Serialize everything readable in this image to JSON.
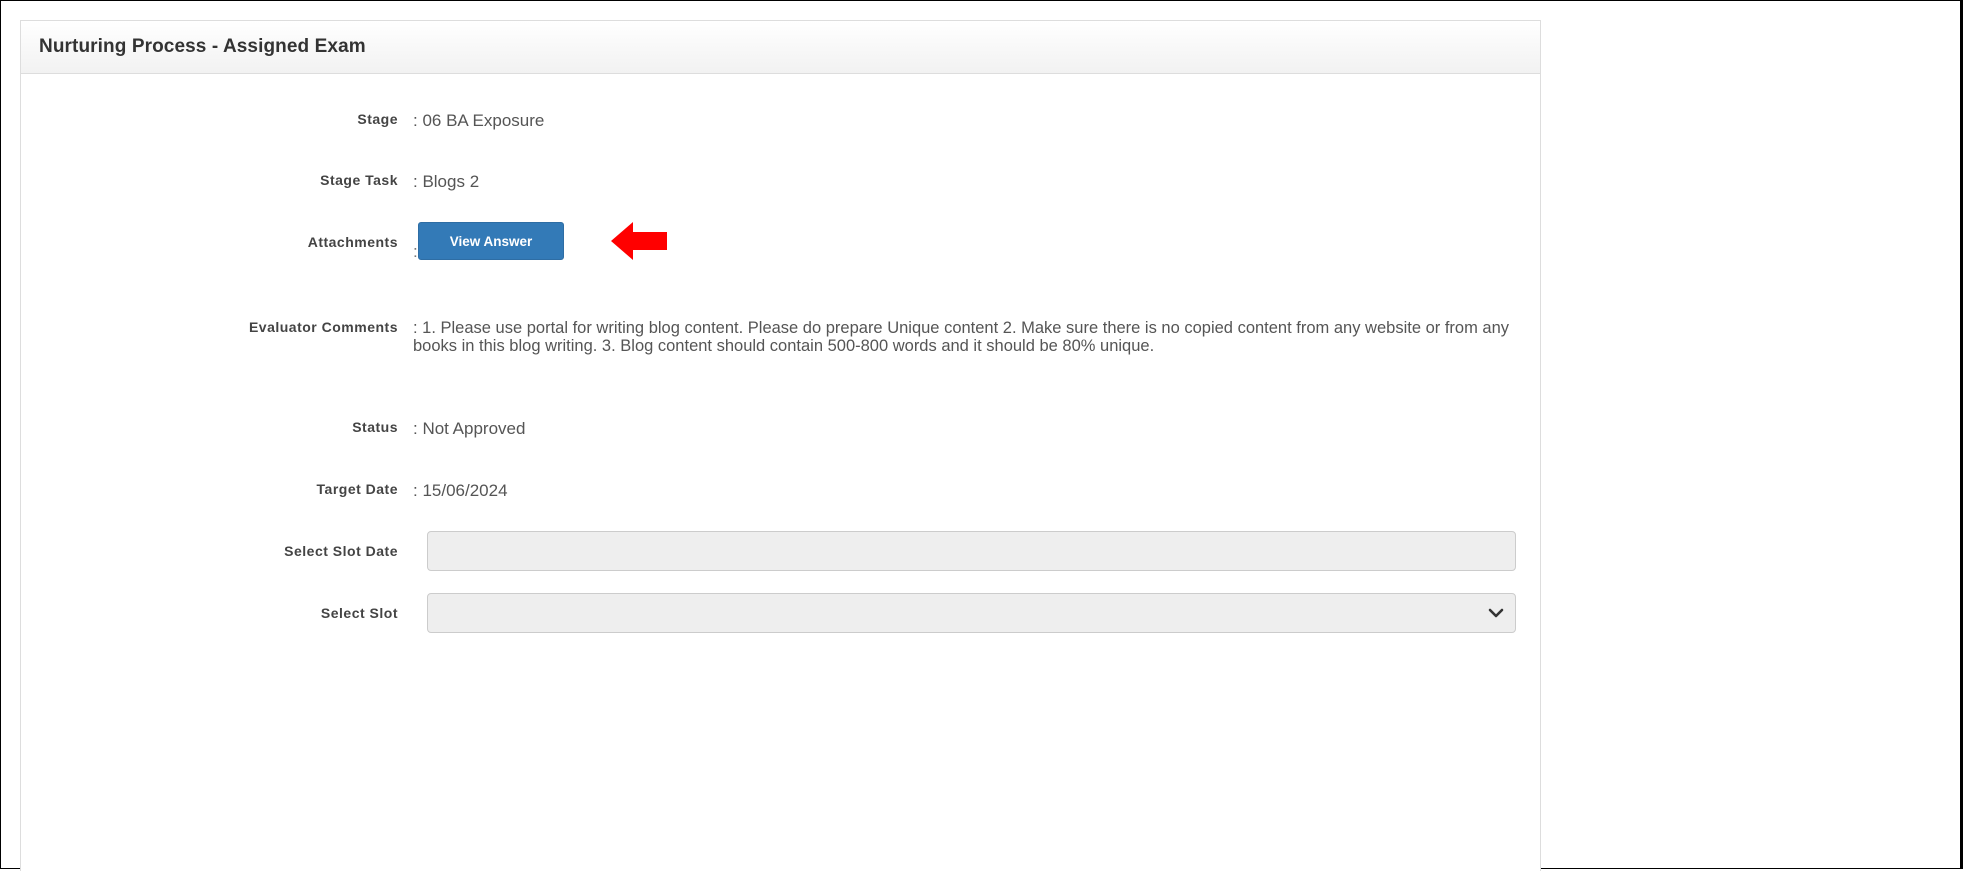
{
  "panel": {
    "title": "Nurturing Process - Assigned Exam"
  },
  "fields": {
    "stage": {
      "label": "Stage",
      "value": ": 06 BA Exposure"
    },
    "stage_task": {
      "label": "Stage Task",
      "value": ": Blogs 2"
    },
    "attachments": {
      "label": "Attachments",
      "colon": ":",
      "button_label": "View Answer"
    },
    "evaluator_comments": {
      "label": "Evaluator Comments",
      "value": ": 1. Please use portal for writing blog content. Please do prepare Unique content 2. Make sure there is no copied content from any website or from any books in this blog writing. 3. Blog content should contain 500-800 words and it should be 80% unique."
    },
    "status": {
      "label": "Status",
      "value": ": Not Approved"
    },
    "target_date": {
      "label": "Target Date",
      "value": ": 15/06/2024"
    },
    "slot_date": {
      "label": "Select Slot Date",
      "value": ""
    },
    "slot": {
      "label": "Select Slot",
      "selected": ""
    }
  },
  "colors": {
    "button": "#337ab7",
    "arrow": "#ff0000",
    "field_bg": "#eeeeee"
  },
  "icons": {
    "annotation_arrow": "left-arrow-icon",
    "dropdown": "chevron-down-icon"
  }
}
